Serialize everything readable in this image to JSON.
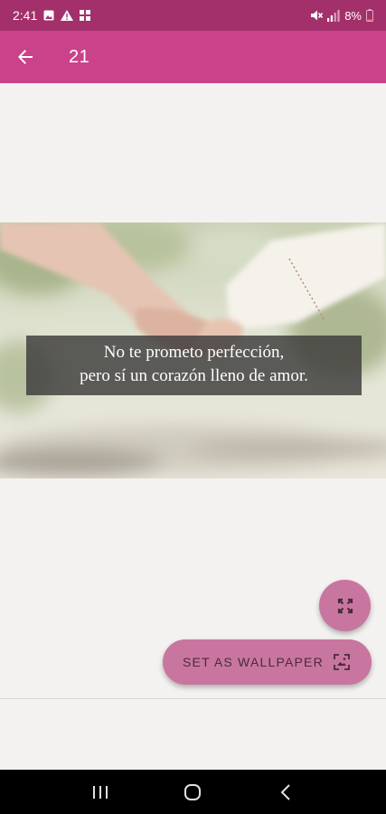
{
  "status_bar": {
    "time": "2:41",
    "battery": "8%",
    "icons": [
      "image-icon",
      "warning-icon",
      "grid-icon",
      "mute-icon",
      "signal-icon",
      "battery-icon"
    ]
  },
  "app_bar": {
    "title": "21",
    "back_icon": "arrow-back-icon",
    "background_color": "#c9428a"
  },
  "image": {
    "quote_line_1": "No te prometo perfección,",
    "quote_line_2": "pero sí un corazón lleno de amor."
  },
  "fab": {
    "icon": "fullscreen-icon"
  },
  "extended_fab": {
    "label": "SET AS WALLPAPER",
    "icon": "wallpaper-icon",
    "color": "#c8769f"
  },
  "nav_bar": {
    "icons": [
      "recents-icon",
      "home-icon",
      "back-icon"
    ]
  }
}
